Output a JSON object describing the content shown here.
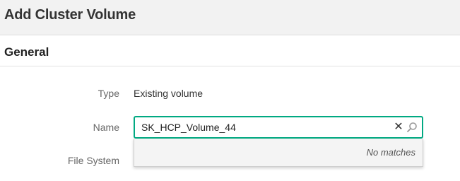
{
  "header": {
    "title": "Add Cluster Volume"
  },
  "section": {
    "title": "General"
  },
  "form": {
    "type": {
      "label": "Type",
      "value": "Existing volume"
    },
    "name": {
      "label": "Name",
      "value": "SK_HCP_Volume_44"
    },
    "file_system": {
      "label": "File System"
    }
  },
  "dropdown": {
    "empty_text": "No matches"
  },
  "icons": {
    "clear": "close-icon",
    "search": "search-icon"
  },
  "colors": {
    "accent": "#01a982",
    "header_bg": "#f2f2f2",
    "dropdown_bg": "#f4f4f4"
  }
}
